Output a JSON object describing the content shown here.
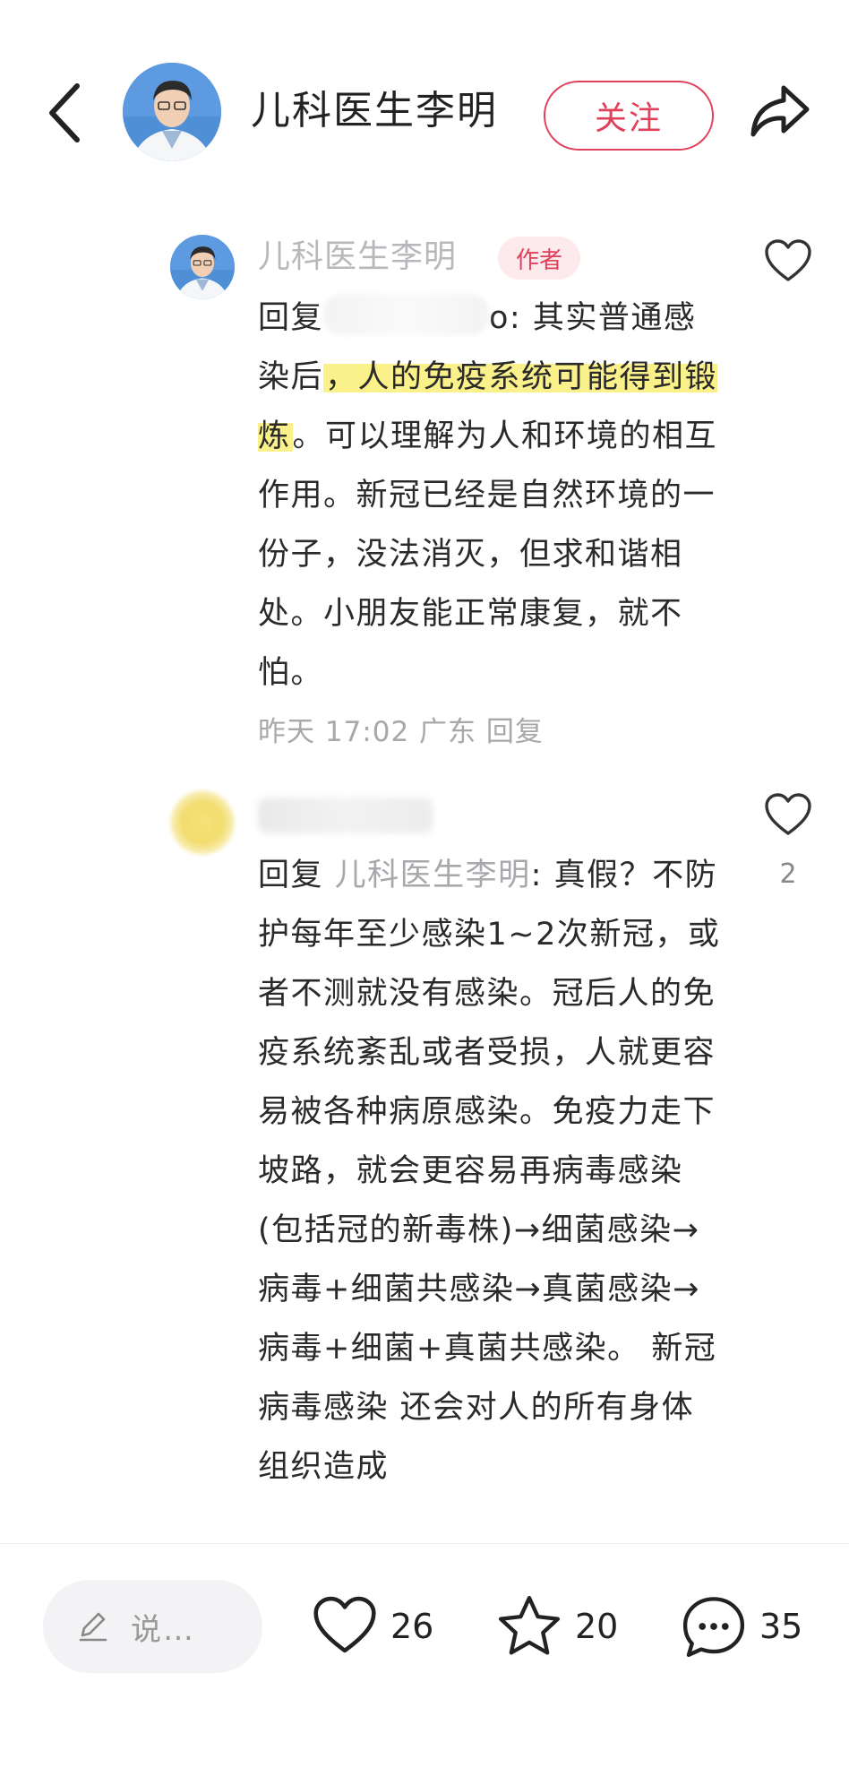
{
  "header": {
    "back_icon": "chevron-left-icon",
    "title": "儿科医生李明",
    "follow_label": "关注",
    "share_icon": "share-arrow-icon"
  },
  "comments": [
    {
      "author": "儿科医生李明",
      "badge": "作者",
      "reply_prefix": "回复",
      "reply_target_suffix": "o: ",
      "text_before": "其实普通感染后",
      "highlight": "，人的免疫系统可能得到锻炼",
      "text_after": "。可以理解为人和环境的相互作用。新冠已经是自然环境的一份子，没法消灭，但求和谐相处。小朋友能正常康复，就不怕。",
      "meta": "昨天 17:02 广东 回复",
      "like_icon": "heart-outline-icon"
    },
    {
      "author": "",
      "reply_prefix": "回复 ",
      "reply_target": "儿科医生李明",
      "text": ": 真假？不防护每年至少感染1~2次新冠，或者不测就没有感染。冠后人的免疫系统紊乱或者受损，人就更容易被各种病原感染。免疫力走下坡路，就会更容易再病毒感染(包括冠的新毒株)→细菌感染→病毒+细菌共感染→真菌感染→病毒+细菌+真菌共感染。 新冠病毒感染 还会对人的所有身体组织造成",
      "like_count": "2",
      "like_icon": "heart-outline-icon"
    }
  ],
  "bottom_bar": {
    "input_placeholder": "说…",
    "likes": "26",
    "favorites": "20",
    "comments": "35"
  }
}
